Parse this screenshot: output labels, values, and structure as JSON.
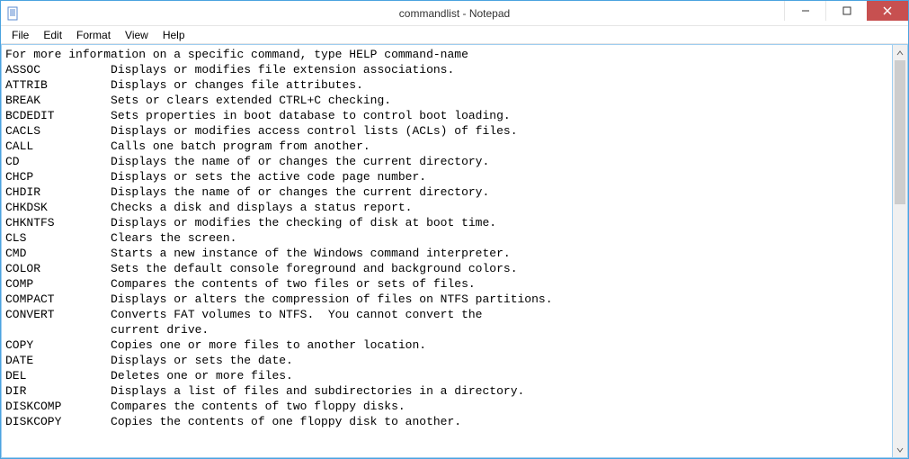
{
  "window": {
    "title": "commandlist - Notepad"
  },
  "menu": {
    "file": "File",
    "edit": "Edit",
    "format": "Format",
    "view": "View",
    "help": "Help"
  },
  "content": "For more information on a specific command, type HELP command-name\nASSOC          Displays or modifies file extension associations.\nATTRIB         Displays or changes file attributes.\nBREAK          Sets or clears extended CTRL+C checking.\nBCDEDIT        Sets properties in boot database to control boot loading.\nCACLS          Displays or modifies access control lists (ACLs) of files.\nCALL           Calls one batch program from another.\nCD             Displays the name of or changes the current directory.\nCHCP           Displays or sets the active code page number.\nCHDIR          Displays the name of or changes the current directory.\nCHKDSK         Checks a disk and displays a status report.\nCHKNTFS        Displays or modifies the checking of disk at boot time.\nCLS            Clears the screen.\nCMD            Starts a new instance of the Windows command interpreter.\nCOLOR          Sets the default console foreground and background colors.\nCOMP           Compares the contents of two files or sets of files.\nCOMPACT        Displays or alters the compression of files on NTFS partitions.\nCONVERT        Converts FAT volumes to NTFS.  You cannot convert the\n               current drive.\nCOPY           Copies one or more files to another location.\nDATE           Displays or sets the date.\nDEL            Deletes one or more files.\nDIR            Displays a list of files and subdirectories in a directory.\nDISKCOMP       Compares the contents of two floppy disks.\nDISKCOPY       Copies the contents of one floppy disk to another."
}
